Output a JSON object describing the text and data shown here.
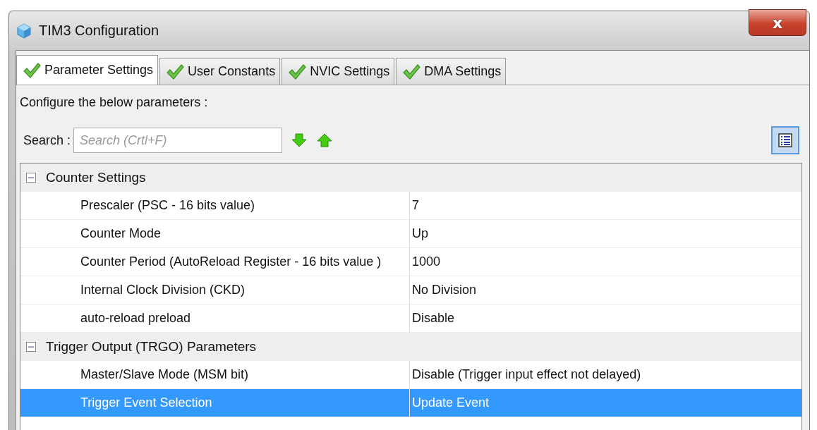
{
  "window": {
    "title": "TIM3 Configuration",
    "close": "x"
  },
  "tabs": [
    {
      "label": "Parameter Settings",
      "selected": true,
      "checked": true
    },
    {
      "label": "User Constants",
      "selected": false,
      "checked": true
    },
    {
      "label": "NVIC Settings",
      "selected": false,
      "checked": true
    },
    {
      "label": "DMA Settings",
      "selected": false,
      "checked": true
    }
  ],
  "description": "Configure the below parameters :",
  "search": {
    "label": "Search :",
    "placeholder": "Search (Crtl+F)"
  },
  "groups": [
    {
      "name": "Counter Settings",
      "expanded": true,
      "rows": [
        {
          "name": "Prescaler (PSC - 16 bits value)",
          "value": "7",
          "selected": false
        },
        {
          "name": "Counter Mode",
          "value": "Up",
          "selected": false
        },
        {
          "name": "Counter Period (AutoReload Register - 16 bits value )",
          "value": "1000",
          "selected": false
        },
        {
          "name": "Internal Clock Division (CKD)",
          "value": "No Division",
          "selected": false
        },
        {
          "name": "auto-reload preload",
          "value": "Disable",
          "selected": false
        }
      ]
    },
    {
      "name": "Trigger Output (TRGO) Parameters",
      "expanded": true,
      "rows": [
        {
          "name": "Master/Slave Mode (MSM bit)",
          "value": "Disable (Trigger input effect not delayed)",
          "selected": false
        },
        {
          "name": "Trigger Event Selection",
          "value": "Update Event",
          "selected": true
        }
      ]
    }
  ]
}
